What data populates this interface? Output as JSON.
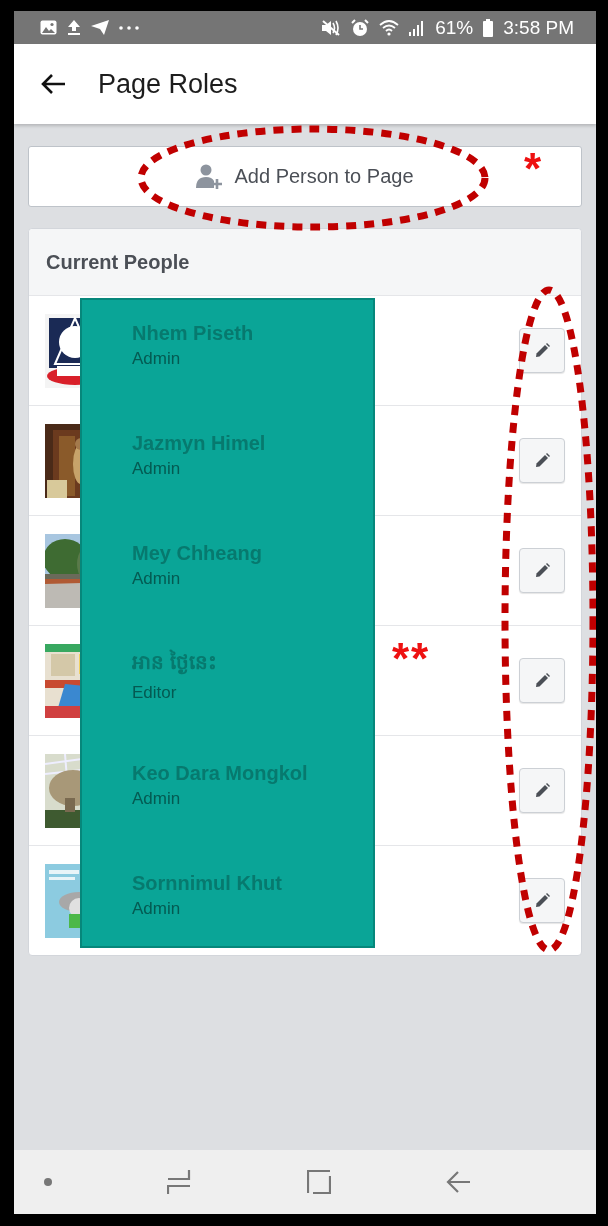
{
  "status_bar": {
    "battery": "61%",
    "time": "3:58 PM"
  },
  "app_bar": {
    "title": "Page Roles"
  },
  "add_button": {
    "label": "Add Person to Page"
  },
  "section": {
    "title": "Current People",
    "people": [
      {
        "name": "Nhem Piseth",
        "role": "Admin"
      },
      {
        "name": "Jazmyn Himel",
        "role": "Admin"
      },
      {
        "name": "Mey Chheang",
        "role": "Admin"
      },
      {
        "name": "អាន ថ្ងៃនេះ",
        "role": "Editor"
      },
      {
        "name": "Keo Dara Mongkol",
        "role": "Admin"
      },
      {
        "name": "Sornnimul Khut",
        "role": "Admin"
      }
    ]
  },
  "annotations": [
    {
      "kind": "asterisk",
      "text": "*"
    },
    {
      "kind": "asterisk",
      "text": "**"
    }
  ]
}
